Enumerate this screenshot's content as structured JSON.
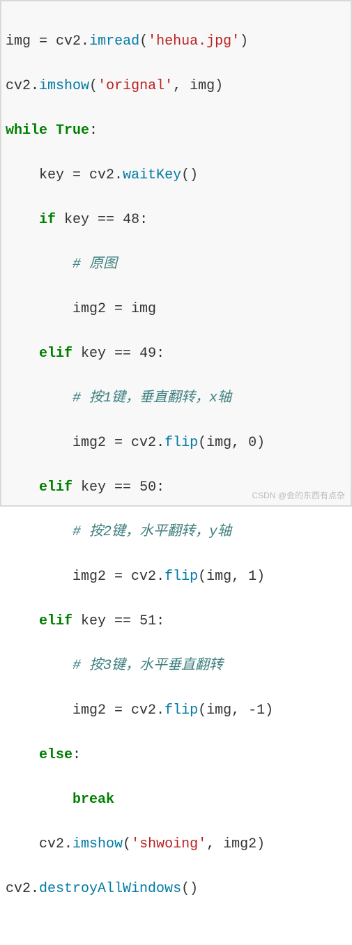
{
  "code": {
    "l1": {
      "a": "img ",
      "b": "=",
      "c": " cv2",
      "d": ".",
      "e": "imread",
      "f": "(",
      "g": "'hehua.jpg'",
      "h": ")"
    },
    "l2": {
      "a": "cv2",
      "b": ".",
      "c": "imshow",
      "d": "(",
      "e": "'orignal'",
      "f": ", img)"
    },
    "l3": {
      "a": "while",
      "b": " ",
      "c": "True",
      "d": ":"
    },
    "l4": {
      "a": "    key ",
      "b": "=",
      "c": " cv2",
      "d": ".",
      "e": "waitKey",
      "f": "()"
    },
    "l5": {
      "a": "    ",
      "b": "if",
      "c": " key ",
      "d": "==",
      "e": " ",
      "f": "48",
      "g": ":"
    },
    "l6": {
      "a": "        ",
      "b": "# 原图"
    },
    "l7": {
      "a": "        img2 ",
      "b": "=",
      "c": " img"
    },
    "l8": {
      "a": "    ",
      "b": "elif",
      "c": " key ",
      "d": "==",
      "e": " ",
      "f": "49",
      "g": ":"
    },
    "l9": {
      "a": "        ",
      "b": "# 按1键，垂直翻转，x轴"
    },
    "l10": {
      "a": "        img2 ",
      "b": "=",
      "c": " cv2",
      "d": ".",
      "e": "flip",
      "f": "(img, ",
      "g": "0",
      "h": ")"
    },
    "l11": {
      "a": "    ",
      "b": "elif",
      "c": " key ",
      "d": "==",
      "e": " ",
      "f": "50",
      "g": ":"
    },
    "l12": {
      "a": "        ",
      "b": "# 按2键，水平翻转，y轴"
    },
    "l13": {
      "a": "        img2 ",
      "b": "=",
      "c": " cv2",
      "d": ".",
      "e": "flip",
      "f": "(img, ",
      "g": "1",
      "h": ")"
    },
    "l14": {
      "a": "    ",
      "b": "elif",
      "c": " key ",
      "d": "==",
      "e": " ",
      "f": "51",
      "g": ":"
    },
    "l15": {
      "a": "        ",
      "b": "# 按3键，水平垂直翻转"
    },
    "l16": {
      "a": "        img2 ",
      "b": "=",
      "c": " cv2",
      "d": ".",
      "e": "flip",
      "f": "(img, ",
      "g": "-",
      "h": "1",
      "i": ")"
    },
    "l17": {
      "a": "    ",
      "b": "else",
      "c": ":"
    },
    "l18": {
      "a": "        ",
      "b": "break"
    },
    "l19": {
      "a": "    cv2",
      "b": ".",
      "c": "imshow",
      "d": "(",
      "e": "'shwoing'",
      "f": ", img2)"
    },
    "l20": {
      "a": "cv2",
      "b": ".",
      "c": "destroyAllWindows",
      "d": "()"
    }
  },
  "watermark": "CSDN @会的东西有点杂"
}
